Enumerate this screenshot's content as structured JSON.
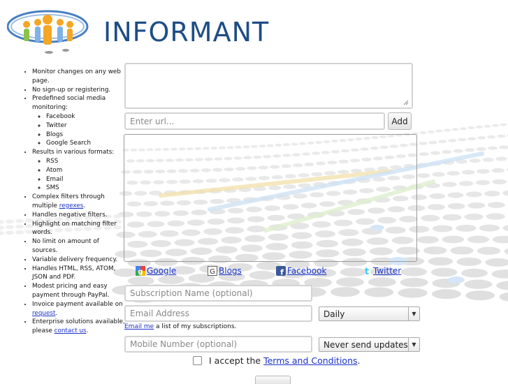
{
  "brand": {
    "name": "INFORMANT"
  },
  "features": {
    "items": [
      {
        "text": "Monitor changes on any web page."
      },
      {
        "text": "No sign-up or registering."
      },
      {
        "text": "Predefined social media monitoring:",
        "sub": [
          "Facebook",
          "Twitter",
          "Blogs",
          "Google Search"
        ]
      },
      {
        "text": "Results in various formats:",
        "sub": [
          "RSS",
          "Atom",
          "Email",
          "SMS"
        ]
      },
      {
        "text_before": "Complex filters through multiple ",
        "link": "regexes",
        "text_after": "."
      },
      {
        "text": "Handles negative filters."
      },
      {
        "text": "Highlight on matching filter words."
      },
      {
        "text": "No limit on amount of sources."
      },
      {
        "text": "Variable delivery frequency."
      },
      {
        "text": "Handles HTML, RSS, ATOM, JSON and PDF."
      },
      {
        "text": "Modest pricing and easy payment through PayPal."
      },
      {
        "text_before": "Invoice payment available on ",
        "link": "request",
        "text_after": "."
      },
      {
        "text_before": "Enterprise solutions available, please ",
        "link": "contact us",
        "text_after": "."
      }
    ]
  },
  "url_input": {
    "placeholder": "Enter url..."
  },
  "add_button": {
    "label": "Add"
  },
  "services": {
    "google": "Google",
    "blogs": "Blogs",
    "facebook": "Facebook",
    "twitter": "Twitter"
  },
  "subscription_name": {
    "placeholder": "Subscription Name (optional)"
  },
  "email": {
    "placeholder": "Email Address"
  },
  "frequency_select": {
    "value": "Daily"
  },
  "email_note": {
    "link": "Email me",
    "text": " a list of my subscriptions."
  },
  "mobile": {
    "placeholder": "Mobile Number (optional)"
  },
  "sms_select": {
    "value": "Never send updates"
  },
  "terms": {
    "prefix": "I accept the ",
    "link": "Terms and Conditions",
    "suffix": "."
  },
  "colors": {
    "brand": "#1d4d86",
    "link": "#1a32c8"
  }
}
